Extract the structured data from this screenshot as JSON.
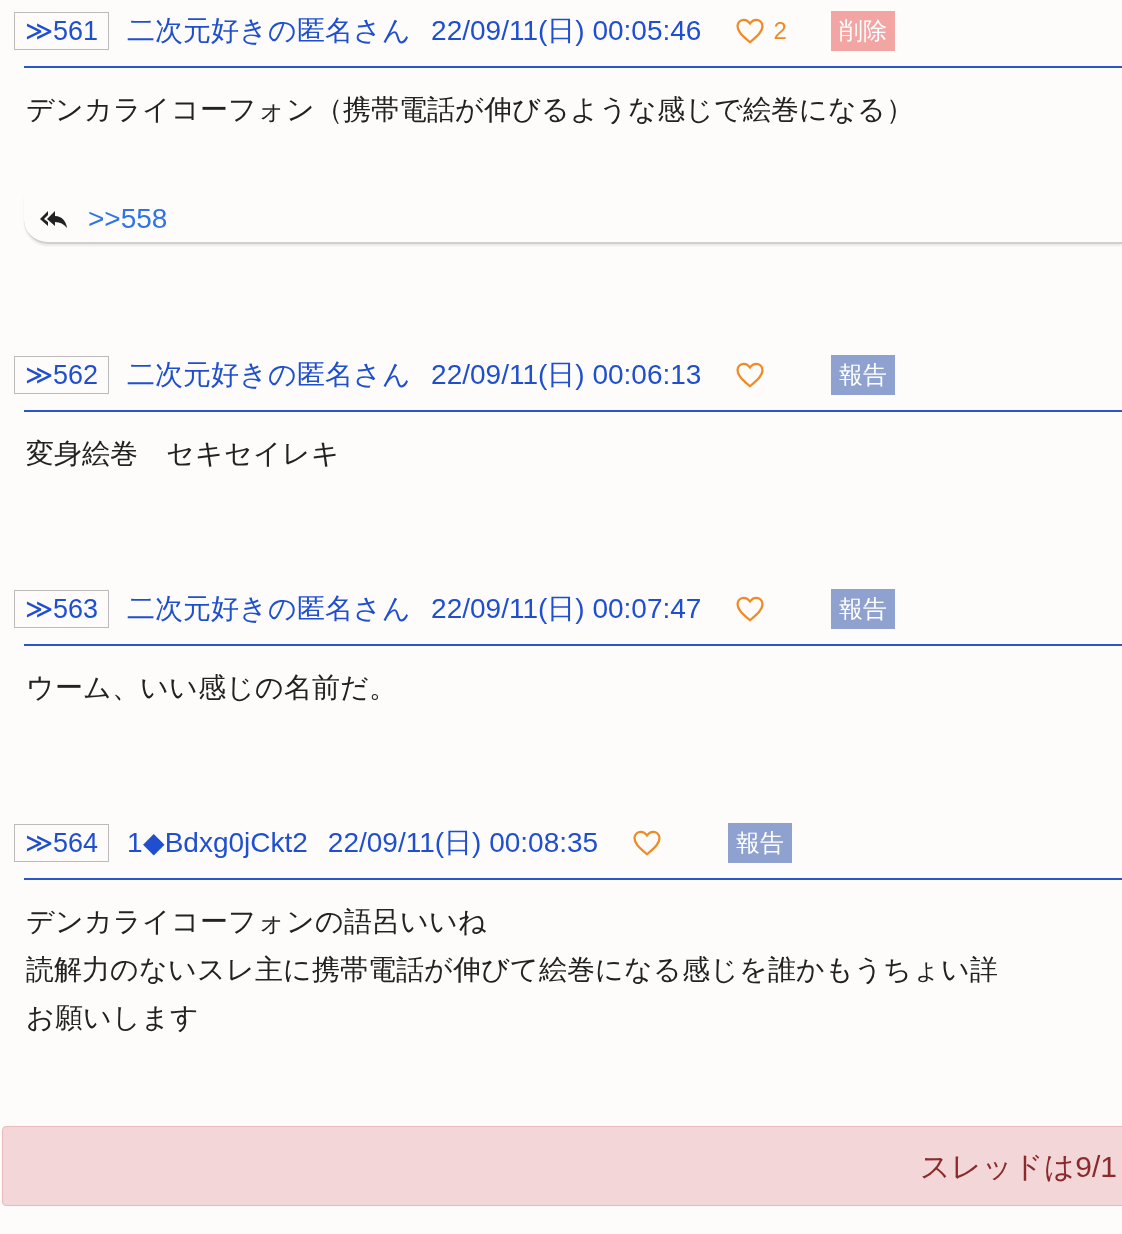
{
  "posts": [
    {
      "number": "≫561",
      "name": "二次元好きの匿名さん",
      "date": "22/09/11(日) 00:05:46",
      "likes": "2",
      "action": {
        "kind": "delete",
        "label": "削除"
      },
      "body": [
        "デンカライコーフォン（携帯電話が伸びるような感じで絵巻になる）"
      ],
      "replies": [
        ">>558"
      ]
    },
    {
      "number": "≫562",
      "name": "二次元好きの匿名さん",
      "date": "22/09/11(日) 00:06:13",
      "action": {
        "kind": "report",
        "label": "報告"
      },
      "body": [
        "変身絵巻　セキセイレキ"
      ]
    },
    {
      "number": "≫563",
      "name": "二次元好きの匿名さん",
      "date": "22/09/11(日) 00:07:47",
      "action": {
        "kind": "report",
        "label": "報告"
      },
      "body": [
        "ウーム、いい感じの名前だ。"
      ]
    },
    {
      "number": "≫564",
      "name": "1◆Bdxg0jCkt2",
      "date": "22/09/11(日) 00:08:35",
      "action": {
        "kind": "report",
        "label": "報告"
      },
      "body": [
        "デンカライコーフォンの語呂いいね",
        "読解力のないスレ主に携帯電話が伸びて絵巻になる感じを誰かもうちょい詳",
        "お願いします"
      ]
    }
  ],
  "notice": "スレッドは9/1"
}
